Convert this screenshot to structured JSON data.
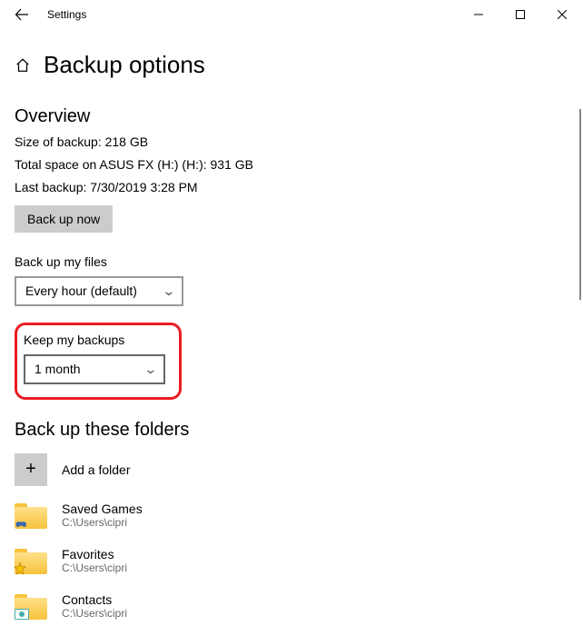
{
  "titlebar": {
    "title": "Settings"
  },
  "heading": "Backup options",
  "overview": {
    "title": "Overview",
    "size_line": "Size of backup: 218 GB",
    "space_line": "Total space on ASUS FX (H:) (H:): 931 GB",
    "last_line": "Last backup: 7/30/2019 3:28 PM",
    "backup_now_label": "Back up now"
  },
  "frequency": {
    "label": "Back up my files",
    "value": "Every hour (default)"
  },
  "retention": {
    "label": "Keep my backups",
    "value": "1 month"
  },
  "folders_section": {
    "title": "Back up these folders",
    "add_label": "Add a folder",
    "items": [
      {
        "name": "Saved Games",
        "path": "C:\\Users\\cipri"
      },
      {
        "name": "Favorites",
        "path": "C:\\Users\\cipri"
      },
      {
        "name": "Contacts",
        "path": "C:\\Users\\cipri"
      }
    ]
  }
}
